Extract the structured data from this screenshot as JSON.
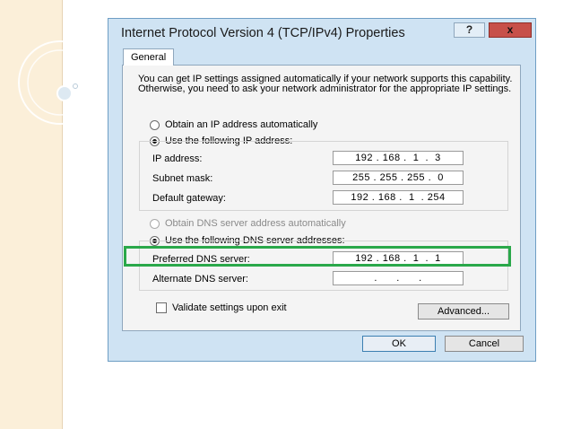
{
  "dialog": {
    "title": "Internet Protocol Version 4 (TCP/IPv4) Properties",
    "help_label": "?",
    "close_label": "x",
    "tab_general": "General",
    "intro_text": "You can get IP settings assigned automatically if your network supports this capability. Otherwise, you need to ask your network administrator for the appropriate IP settings.",
    "ip": {
      "auto_label": "Obtain an IP address automatically",
      "manual_label": "Use the following IP address:",
      "selected": "manual",
      "fields": [
        {
          "label": "IP address:",
          "value": "192 . 168 .  1  .  3"
        },
        {
          "label": "Subnet mask:",
          "value": "255 . 255 . 255 .  0"
        },
        {
          "label": "Default gateway:",
          "value": "192 . 168 .  1  . 254"
        }
      ]
    },
    "dns": {
      "auto_label": "Obtain DNS server address automatically",
      "manual_label": "Use the following DNS server addresses:",
      "selected": "manual",
      "fields": [
        {
          "label": "Preferred DNS server:",
          "value": "192 . 168 .  1  .  1"
        },
        {
          "label": "Alternate DNS server:",
          "value": ".      .      ."
        }
      ]
    },
    "validate_label": "Validate settings upon exit",
    "validate_checked": false,
    "advanced_label": "Advanced...",
    "ok_label": "OK",
    "cancel_label": "Cancel"
  },
  "colors": {
    "dialog_bg": "#cfe3f3",
    "close_button": "#c7504a",
    "highlight_box": "#2aa84a",
    "slide_strip": "#fbefd9"
  }
}
